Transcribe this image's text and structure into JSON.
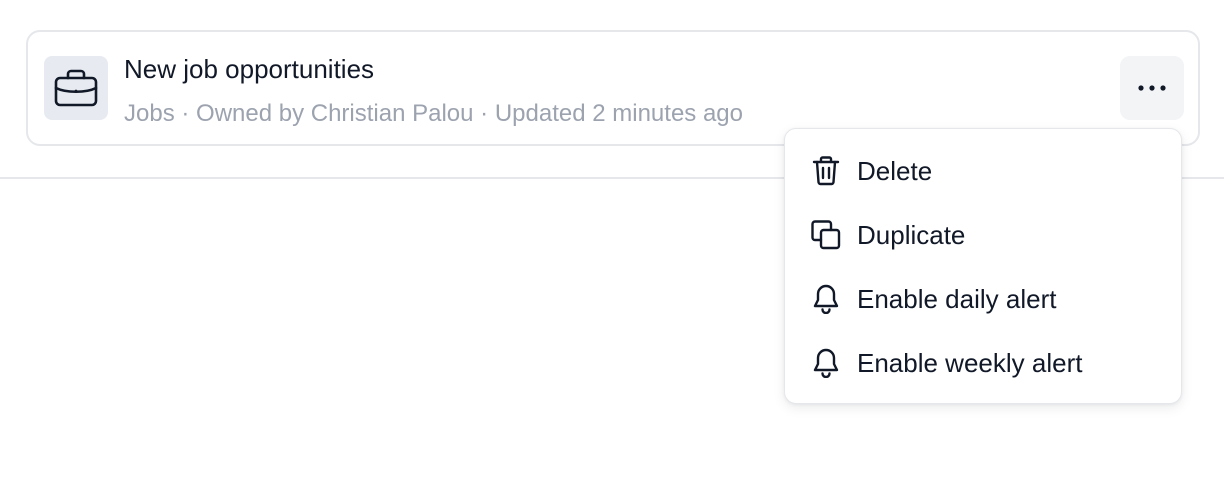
{
  "card": {
    "icon": "briefcase-icon",
    "title": "New job opportunities",
    "meta": "Jobs · Owned by Christian Palou · Updated 2 minutes ago",
    "menu_icon": "ellipsis-horizontal-icon"
  },
  "dropdown": {
    "items": [
      {
        "label": "Delete",
        "icon": "trash-icon"
      },
      {
        "label": "Duplicate",
        "icon": "duplicate-icon"
      },
      {
        "label": "Enable daily alert",
        "icon": "bell-icon"
      },
      {
        "label": "Enable weekly alert",
        "icon": "bell-icon"
      }
    ]
  },
  "colors": {
    "text_primary": "#111827",
    "text_muted": "#9ca3af",
    "border": "#e5e7eb",
    "icon_tile": "#e7ebf1",
    "menu_button_bg": "#f3f4f6"
  }
}
